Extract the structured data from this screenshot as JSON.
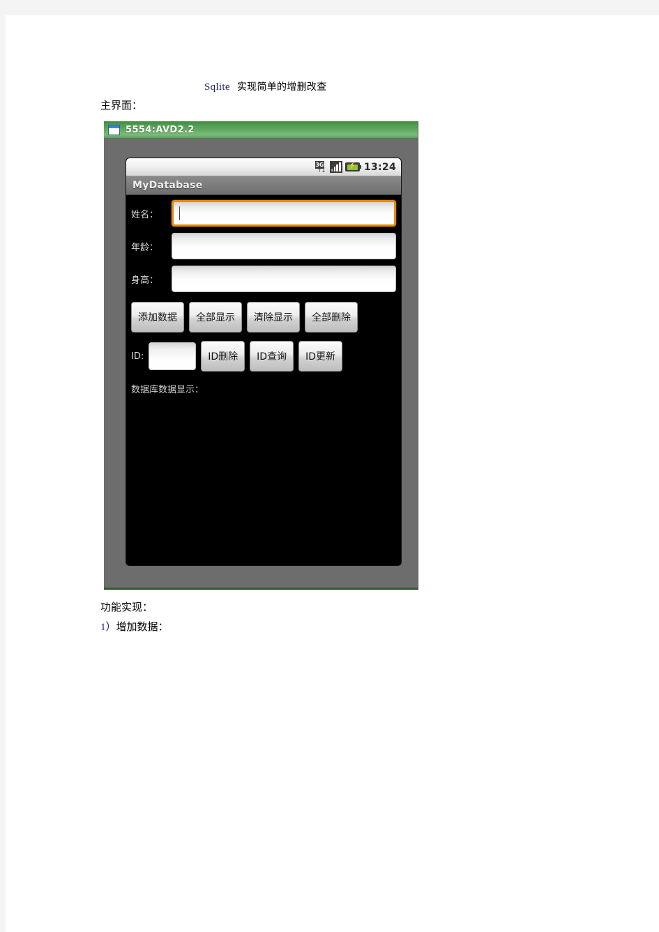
{
  "document": {
    "title_en": "Sqlite",
    "title_cn": "实现简单的增删改查",
    "main_ui_label": "主界面：",
    "function_label": "功能实现：",
    "item1_num": "1）",
    "item1_label": "增加数据："
  },
  "emulator": {
    "window_title": "5554:AVD2.2",
    "window_icon": "window-icon",
    "frame_color": "#6d6d6d",
    "titlebar_color": "#64ad64"
  },
  "android": {
    "status_bar": {
      "network_icon": "3g-icon",
      "network_label": "3G",
      "network_arrows": "↑↓",
      "signal_icon": "signal-bars-icon",
      "battery_icon": "battery-charging-icon",
      "battery_bolt": "⚡",
      "clock": "13:24"
    },
    "app_bar": {
      "title": "MyDatabase"
    },
    "form": {
      "fields": [
        {
          "label": "姓名：",
          "value": "",
          "focused": true
        },
        {
          "label": "年龄：",
          "value": "",
          "focused": false
        },
        {
          "label": "身高：",
          "value": "",
          "focused": false
        }
      ],
      "action_buttons": [
        {
          "label": "添加数据"
        },
        {
          "label": "全部显示"
        },
        {
          "label": "清除显示"
        },
        {
          "label": "全部删除"
        }
      ],
      "id_label": "ID:",
      "id_value": "",
      "id_buttons": [
        {
          "label": "ID删除"
        },
        {
          "label": "ID查询"
        },
        {
          "label": "ID更新"
        }
      ],
      "display_label": "数据库数据显示：",
      "display_content": ""
    },
    "accent_focus_color": "#e8890c"
  }
}
